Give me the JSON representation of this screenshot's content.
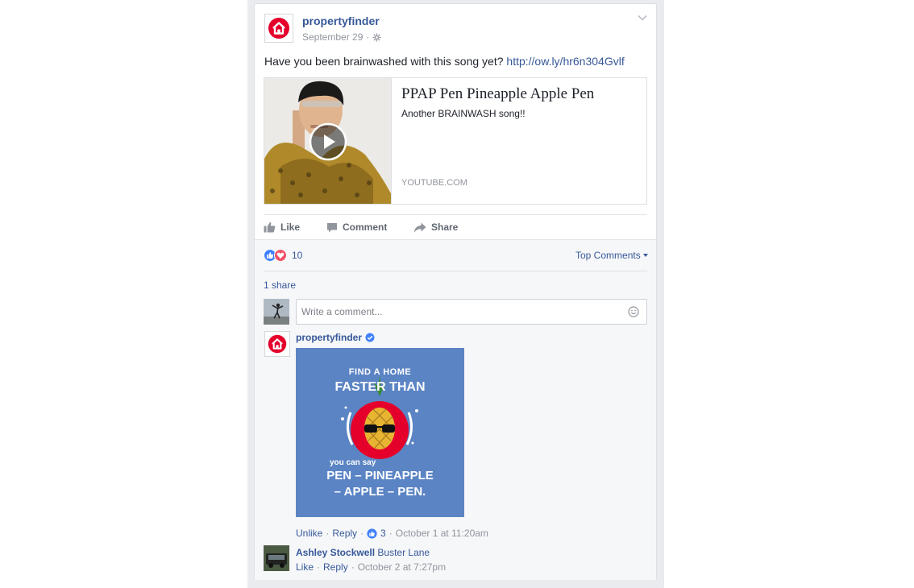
{
  "post": {
    "page_name": "propertyfinder",
    "date": "September 29",
    "separator": "·",
    "text": "Have you been brainwashed with this song yet?",
    "url": "http://ow.ly/hr6n304Gvlf"
  },
  "link_preview": {
    "title": "PPAP Pen Pineapple Apple Pen",
    "description": "Another BRAINWASH song!!",
    "domain": "YOUTUBE.COM"
  },
  "actions": {
    "like": "Like",
    "comment": "Comment",
    "share": "Share"
  },
  "reactions": {
    "count": "10",
    "sort_label": "Top Comments",
    "shares": "1 share"
  },
  "composer": {
    "placeholder": "Write a comment..."
  },
  "comment1": {
    "author": "propertyfinder",
    "image_text": {
      "line1": "FIND A HOME",
      "line2": "FASTER THAN",
      "line3": "you can say",
      "line4": "PEN – PINEAPPLE",
      "line5": "– APPLE – PEN."
    },
    "unlike": "Unlike",
    "reply": "Reply",
    "likes": "3",
    "time": "October 1 at 11:20am",
    "sep": "·"
  },
  "comment2": {
    "author": "Ashley Stockwell",
    "text": "Buster Lane",
    "like": "Like",
    "reply": "Reply",
    "time": "October 2 at 7:27pm",
    "sep": "·"
  },
  "colors": {
    "brand_red": "#e4002b",
    "fb_blue": "#365899",
    "promo_bg": "#5b84c4"
  }
}
